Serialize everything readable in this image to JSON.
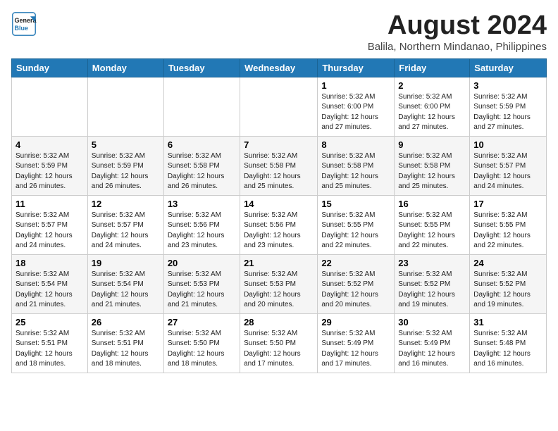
{
  "header": {
    "logo_line1": "General",
    "logo_line2": "Blue",
    "month": "August 2024",
    "location": "Balila, Northern Mindanao, Philippines"
  },
  "days_of_week": [
    "Sunday",
    "Monday",
    "Tuesday",
    "Wednesday",
    "Thursday",
    "Friday",
    "Saturday"
  ],
  "weeks": [
    [
      {
        "day": "",
        "detail": ""
      },
      {
        "day": "",
        "detail": ""
      },
      {
        "day": "",
        "detail": ""
      },
      {
        "day": "",
        "detail": ""
      },
      {
        "day": "1",
        "detail": "Sunrise: 5:32 AM\nSunset: 6:00 PM\nDaylight: 12 hours\nand 27 minutes."
      },
      {
        "day": "2",
        "detail": "Sunrise: 5:32 AM\nSunset: 6:00 PM\nDaylight: 12 hours\nand 27 minutes."
      },
      {
        "day": "3",
        "detail": "Sunrise: 5:32 AM\nSunset: 5:59 PM\nDaylight: 12 hours\nand 27 minutes."
      }
    ],
    [
      {
        "day": "4",
        "detail": "Sunrise: 5:32 AM\nSunset: 5:59 PM\nDaylight: 12 hours\nand 26 minutes."
      },
      {
        "day": "5",
        "detail": "Sunrise: 5:32 AM\nSunset: 5:59 PM\nDaylight: 12 hours\nand 26 minutes."
      },
      {
        "day": "6",
        "detail": "Sunrise: 5:32 AM\nSunset: 5:58 PM\nDaylight: 12 hours\nand 26 minutes."
      },
      {
        "day": "7",
        "detail": "Sunrise: 5:32 AM\nSunset: 5:58 PM\nDaylight: 12 hours\nand 25 minutes."
      },
      {
        "day": "8",
        "detail": "Sunrise: 5:32 AM\nSunset: 5:58 PM\nDaylight: 12 hours\nand 25 minutes."
      },
      {
        "day": "9",
        "detail": "Sunrise: 5:32 AM\nSunset: 5:58 PM\nDaylight: 12 hours\nand 25 minutes."
      },
      {
        "day": "10",
        "detail": "Sunrise: 5:32 AM\nSunset: 5:57 PM\nDaylight: 12 hours\nand 24 minutes."
      }
    ],
    [
      {
        "day": "11",
        "detail": "Sunrise: 5:32 AM\nSunset: 5:57 PM\nDaylight: 12 hours\nand 24 minutes."
      },
      {
        "day": "12",
        "detail": "Sunrise: 5:32 AM\nSunset: 5:57 PM\nDaylight: 12 hours\nand 24 minutes."
      },
      {
        "day": "13",
        "detail": "Sunrise: 5:32 AM\nSunset: 5:56 PM\nDaylight: 12 hours\nand 23 minutes."
      },
      {
        "day": "14",
        "detail": "Sunrise: 5:32 AM\nSunset: 5:56 PM\nDaylight: 12 hours\nand 23 minutes."
      },
      {
        "day": "15",
        "detail": "Sunrise: 5:32 AM\nSunset: 5:55 PM\nDaylight: 12 hours\nand 22 minutes."
      },
      {
        "day": "16",
        "detail": "Sunrise: 5:32 AM\nSunset: 5:55 PM\nDaylight: 12 hours\nand 22 minutes."
      },
      {
        "day": "17",
        "detail": "Sunrise: 5:32 AM\nSunset: 5:55 PM\nDaylight: 12 hours\nand 22 minutes."
      }
    ],
    [
      {
        "day": "18",
        "detail": "Sunrise: 5:32 AM\nSunset: 5:54 PM\nDaylight: 12 hours\nand 21 minutes."
      },
      {
        "day": "19",
        "detail": "Sunrise: 5:32 AM\nSunset: 5:54 PM\nDaylight: 12 hours\nand 21 minutes."
      },
      {
        "day": "20",
        "detail": "Sunrise: 5:32 AM\nSunset: 5:53 PM\nDaylight: 12 hours\nand 21 minutes."
      },
      {
        "day": "21",
        "detail": "Sunrise: 5:32 AM\nSunset: 5:53 PM\nDaylight: 12 hours\nand 20 minutes."
      },
      {
        "day": "22",
        "detail": "Sunrise: 5:32 AM\nSunset: 5:52 PM\nDaylight: 12 hours\nand 20 minutes."
      },
      {
        "day": "23",
        "detail": "Sunrise: 5:32 AM\nSunset: 5:52 PM\nDaylight: 12 hours\nand 19 minutes."
      },
      {
        "day": "24",
        "detail": "Sunrise: 5:32 AM\nSunset: 5:52 PM\nDaylight: 12 hours\nand 19 minutes."
      }
    ],
    [
      {
        "day": "25",
        "detail": "Sunrise: 5:32 AM\nSunset: 5:51 PM\nDaylight: 12 hours\nand 18 minutes."
      },
      {
        "day": "26",
        "detail": "Sunrise: 5:32 AM\nSunset: 5:51 PM\nDaylight: 12 hours\nand 18 minutes."
      },
      {
        "day": "27",
        "detail": "Sunrise: 5:32 AM\nSunset: 5:50 PM\nDaylight: 12 hours\nand 18 minutes."
      },
      {
        "day": "28",
        "detail": "Sunrise: 5:32 AM\nSunset: 5:50 PM\nDaylight: 12 hours\nand 17 minutes."
      },
      {
        "day": "29",
        "detail": "Sunrise: 5:32 AM\nSunset: 5:49 PM\nDaylight: 12 hours\nand 17 minutes."
      },
      {
        "day": "30",
        "detail": "Sunrise: 5:32 AM\nSunset: 5:49 PM\nDaylight: 12 hours\nand 16 minutes."
      },
      {
        "day": "31",
        "detail": "Sunrise: 5:32 AM\nSunset: 5:48 PM\nDaylight: 12 hours\nand 16 minutes."
      }
    ]
  ]
}
